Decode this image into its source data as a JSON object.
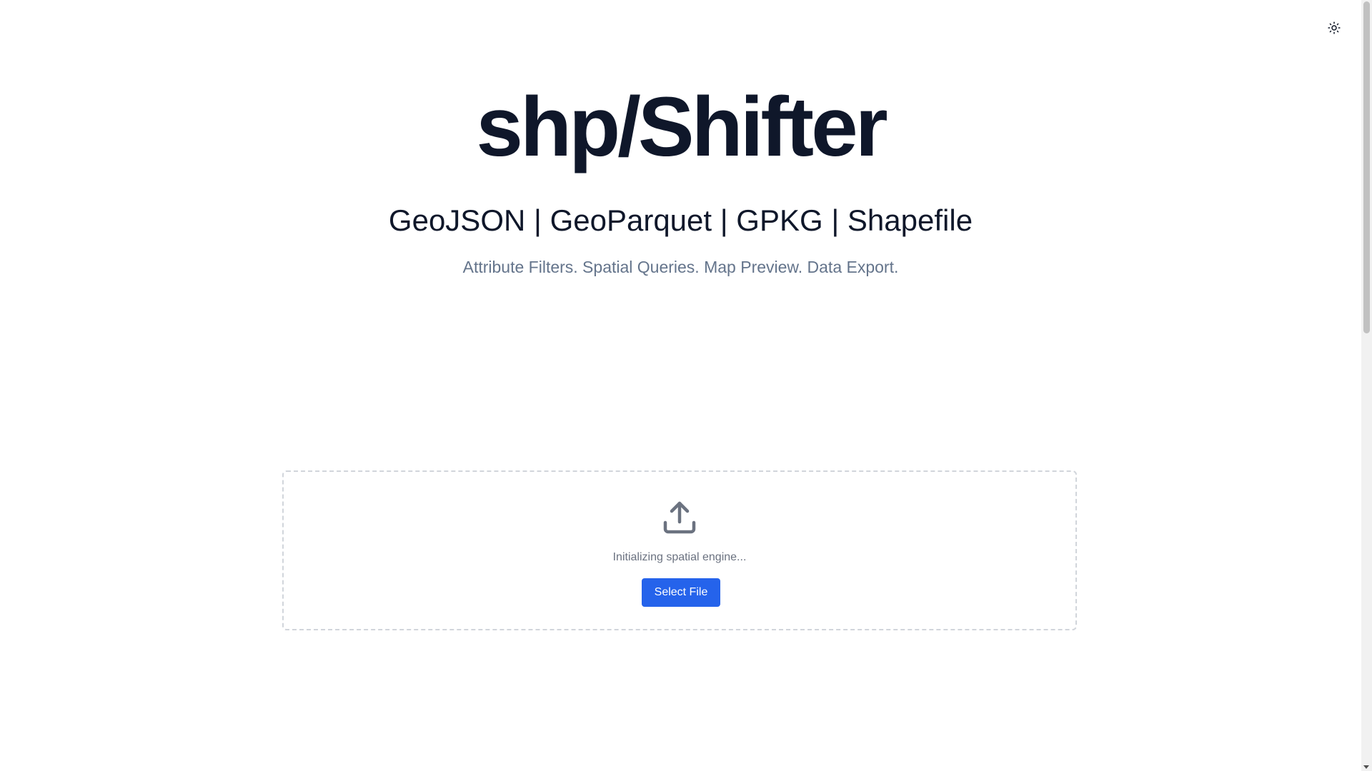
{
  "header": {
    "theme_toggle_icon": "sun-icon"
  },
  "hero": {
    "title": "shp/Shifter",
    "formats": "GeoJSON | GeoParquet | GPKG | Shapefile",
    "features": "Attribute Filters. Spatial Queries. Map Preview. Data Export."
  },
  "dropzone": {
    "icon": "upload-icon",
    "status_text": "Initializing spatial engine...",
    "button_label": "Select File"
  },
  "colors": {
    "title": "#0f172a",
    "features_text": "#64748b",
    "button_bg": "#2563eb",
    "dropzone_border": "#d1d5db",
    "icon_gray": "#6b7280"
  }
}
